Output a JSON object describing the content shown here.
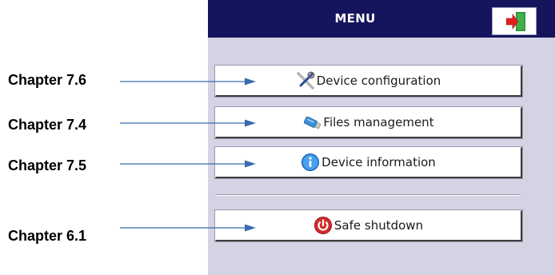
{
  "menu": {
    "title": "MENU",
    "exit_icon": "exit-door-icon",
    "buttons": [
      {
        "label": "Device configuration",
        "icon": "tools-icon"
      },
      {
        "label": "Files management",
        "icon": "usb-drive-icon"
      },
      {
        "label": "Device information",
        "icon": "info-icon"
      },
      {
        "label": "Safe shutdown",
        "icon": "power-icon"
      }
    ]
  },
  "annotations": [
    {
      "label": "Chapter 7.6"
    },
    {
      "label": "Chapter 7.4"
    },
    {
      "label": "Chapter 7.5"
    },
    {
      "label": "Chapter 6.1"
    }
  ],
  "colors": {
    "titlebar": "#15155e",
    "panel": "#d4d3e3",
    "arrow": "#3a6ab0",
    "exit_red": "#e02020",
    "exit_green": "#2f8f3a"
  }
}
